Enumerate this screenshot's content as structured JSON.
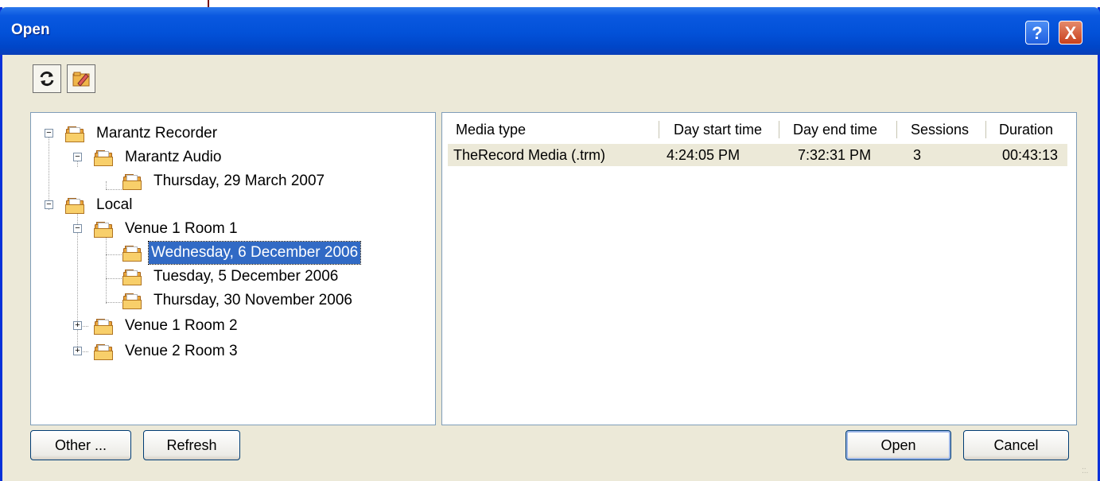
{
  "window": {
    "title": "Open",
    "help": "?",
    "close": "X"
  },
  "toolbar": {
    "refresh_icon": "refresh-icon",
    "edit_folder_icon": "folder-edit-icon"
  },
  "tree": {
    "items": [
      {
        "label": "Marantz Recorder"
      },
      {
        "label": "Marantz Audio"
      },
      {
        "label": "Thursday, 29 March 2007"
      },
      {
        "label": "Local"
      },
      {
        "label": "Venue 1 Room 1"
      },
      {
        "label": "Wednesday, 6 December 2006",
        "selected": true
      },
      {
        "label": "Tuesday, 5 December 2006"
      },
      {
        "label": "Thursday, 30 November 2006"
      },
      {
        "label": "Venue 1 Room 2"
      },
      {
        "label": "Venue 2 Room 3"
      }
    ],
    "expander_minus": "−",
    "expander_plus": "+"
  },
  "list": {
    "columns": [
      "Media type",
      "Day start time",
      "Day end time",
      "Sessions",
      "Duration"
    ],
    "rows": [
      [
        "TheRecord Media (.trm)",
        "4:24:05 PM",
        "7:32:31 PM",
        "3",
        "00:43:13"
      ]
    ]
  },
  "buttons": {
    "other": "Other ...",
    "refresh": "Refresh",
    "open": "Open",
    "cancel": "Cancel"
  },
  "colors": {
    "title_bar": "#0251d8",
    "selection": "#316ac5",
    "annotation_arrow": "#7a0b0b"
  }
}
